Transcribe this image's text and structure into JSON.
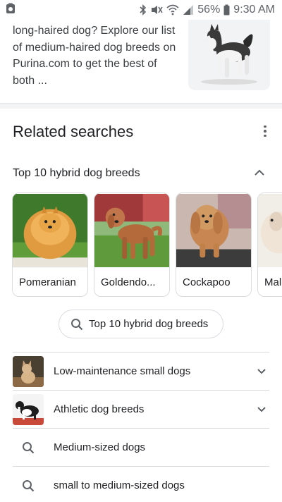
{
  "status_bar": {
    "battery_text": "56%",
    "time": "9:30 AM",
    "icons": [
      "notification-icon",
      "bluetooth-icon",
      "mute-icon",
      "wifi-icon",
      "signal-icon",
      "battery-icon"
    ]
  },
  "snippet": {
    "lines": [
      "long-haired dog? Explore our list",
      "of medium-haired dog breeds on",
      "Purina.com to get the best of",
      "both ..."
    ],
    "thumbnail": "husky-dog-image"
  },
  "related_searches": {
    "title": "Related searches",
    "group": {
      "title": "Top 10 hybrid dog breeds",
      "cards": [
        {
          "label": "Pomeranian",
          "image": "pomeranian-image"
        },
        {
          "label": "Goldendo...",
          "image": "goldendoodle-image"
        },
        {
          "label": "Cockapoo",
          "image": "cockapoo-image"
        },
        {
          "label": "Mal",
          "image": "maltipoo-image"
        }
      ],
      "search_button_label": "Top 10 hybrid dog breeds"
    },
    "rows": [
      {
        "label": "Low-maintenance small dogs",
        "icon": "dog-thumbnail",
        "expandable": true
      },
      {
        "label": "Athletic dog breeds",
        "icon": "dog-thumbnail",
        "expandable": true
      },
      {
        "label": "Medium-sized dogs",
        "icon": "search-icon",
        "expandable": false
      },
      {
        "label": "small to medium-sized dogs",
        "icon": "search-icon",
        "expandable": false
      }
    ]
  },
  "colors": {
    "text": "#202124",
    "secondary": "#5f6368",
    "border": "#dadce0",
    "separator": "#f1f3f4"
  }
}
